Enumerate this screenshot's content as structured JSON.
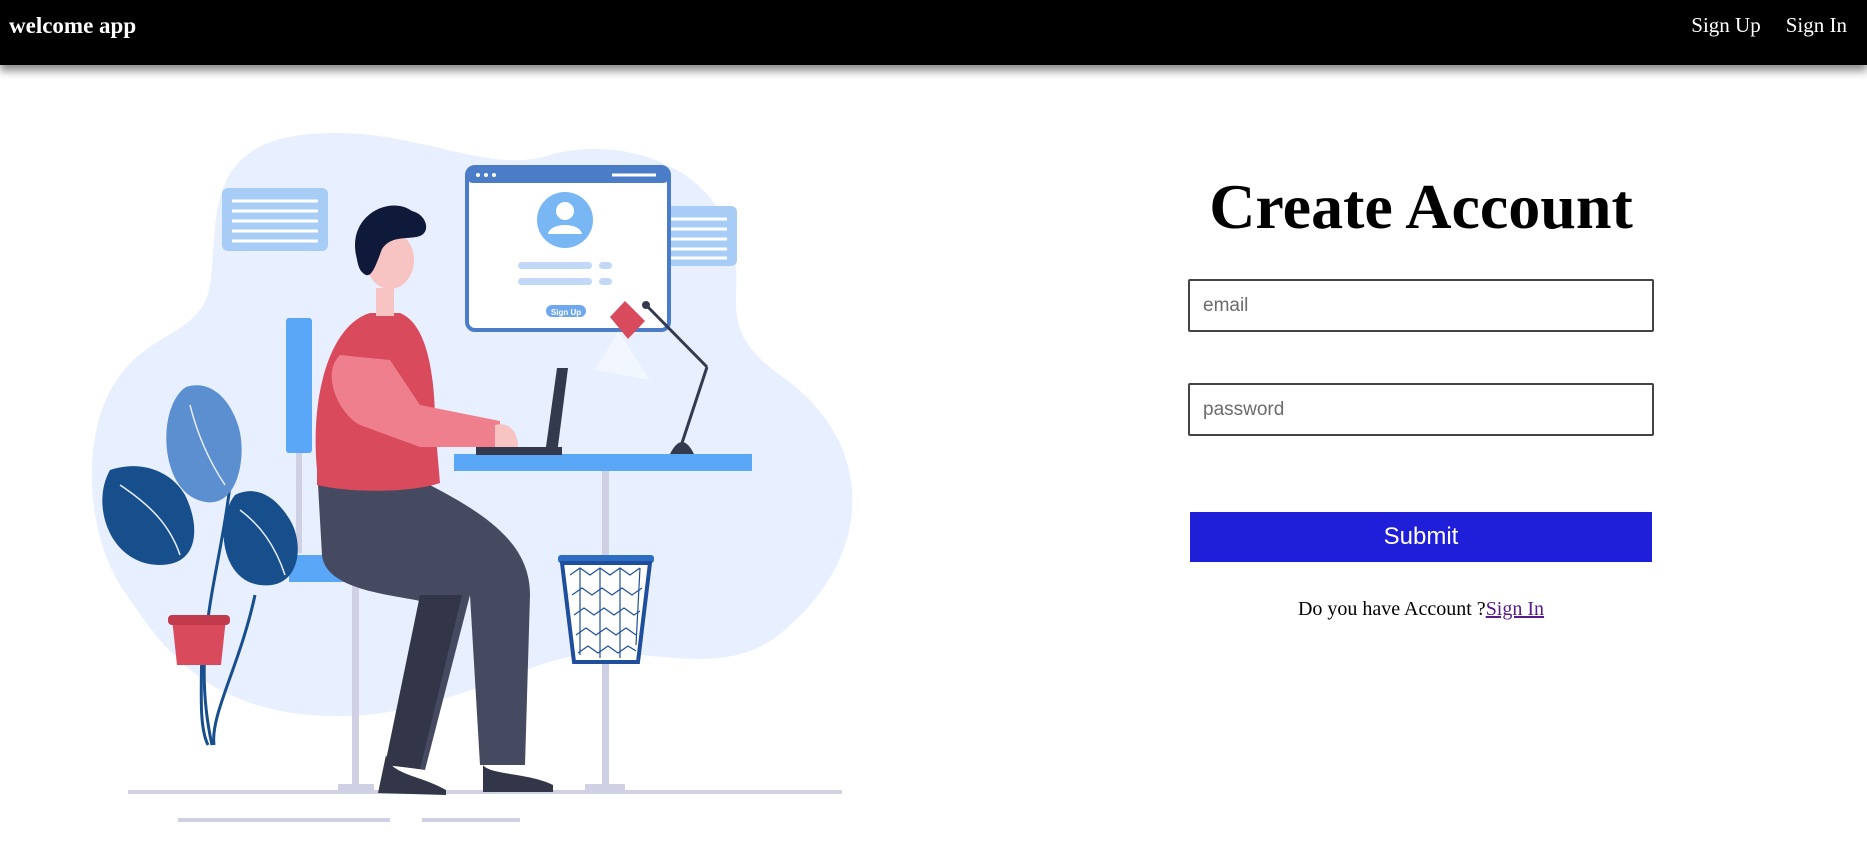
{
  "header": {
    "brand": "welcome app",
    "nav": [
      {
        "label": "Sign Up"
      },
      {
        "label": "Sign In"
      }
    ]
  },
  "illustration": {
    "mini_window_button": "Sign Up"
  },
  "form": {
    "title": "Create Account",
    "email": {
      "placeholder": "email",
      "value": ""
    },
    "password": {
      "placeholder": "password",
      "value": ""
    },
    "submit_label": "Submit",
    "prompt_text": "Do you have Account ?",
    "prompt_link": "Sign In"
  },
  "colors": {
    "header_bg": "#000000",
    "submit_bg": "#1f1fd9",
    "illustration_blob": "#e8efff",
    "accent_blue": "#5aa7f7",
    "shirt_red": "#d94a5c"
  },
  "icons": {
    "profile": "user-avatar-icon"
  }
}
